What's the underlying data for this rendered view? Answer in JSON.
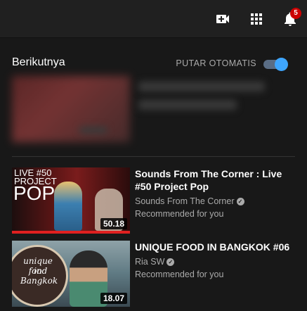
{
  "header": {
    "icons": [
      "video-camera-add-icon",
      "apps-grid-icon",
      "notification-bell-icon"
    ],
    "notification_count": "5"
  },
  "upnext": {
    "title": "Berikutnya",
    "autoplay_label": "PUTAR OTOMATIS",
    "autoplay_on": true
  },
  "videos": [
    {
      "title": "Sounds From The Corner : Live #50 Project Pop",
      "channel": "Sounds From The Corner",
      "verified": true,
      "note": "Recommended for you",
      "duration": "50.18",
      "thumb_text": [
        "LIVE #50",
        "PROJECT",
        "POP"
      ]
    },
    {
      "title": "UNIQUE FOOD IN BANGKOK #06",
      "channel": "Ria SW",
      "verified": true,
      "note": "Recommended for you",
      "duration": "18.07",
      "thumb_text": [
        "unique food",
        "in",
        "Bangkok"
      ]
    }
  ],
  "colors": {
    "accent": "#3ea6ff",
    "badge": "#cc0000",
    "background": "#181818",
    "header": "#202020"
  }
}
